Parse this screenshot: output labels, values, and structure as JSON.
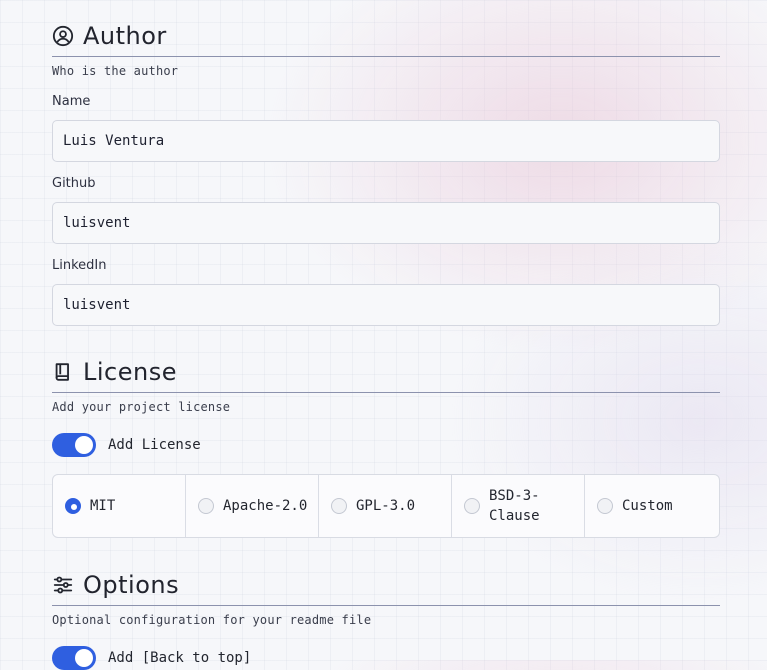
{
  "author": {
    "title": "Author",
    "icon": "user-circle-icon",
    "description": "Who is the author",
    "fields": {
      "name": {
        "label": "Name",
        "value": "Luis Ventura"
      },
      "github": {
        "label": "Github",
        "value": "luisvent"
      },
      "linkedin": {
        "label": "LinkedIn",
        "value": "luisvent"
      }
    }
  },
  "license": {
    "title": "License",
    "icon": "book-icon",
    "description": "Add your project license",
    "toggle_label": "Add License",
    "toggle_on": true,
    "selected": "MIT",
    "options": [
      "MIT",
      "Apache-2.0",
      "GPL-3.0",
      "BSD-3-\nClause",
      "Custom"
    ]
  },
  "options": {
    "title": "Options",
    "icon": "sliders-icon",
    "description": "Optional configuration for your readme file",
    "toggle_label": "Add [Back to top]",
    "toggle_on": true
  },
  "colors": {
    "accent": "#2f5fe0",
    "border": "#d4d7e0",
    "rule": "#8c92ad"
  }
}
